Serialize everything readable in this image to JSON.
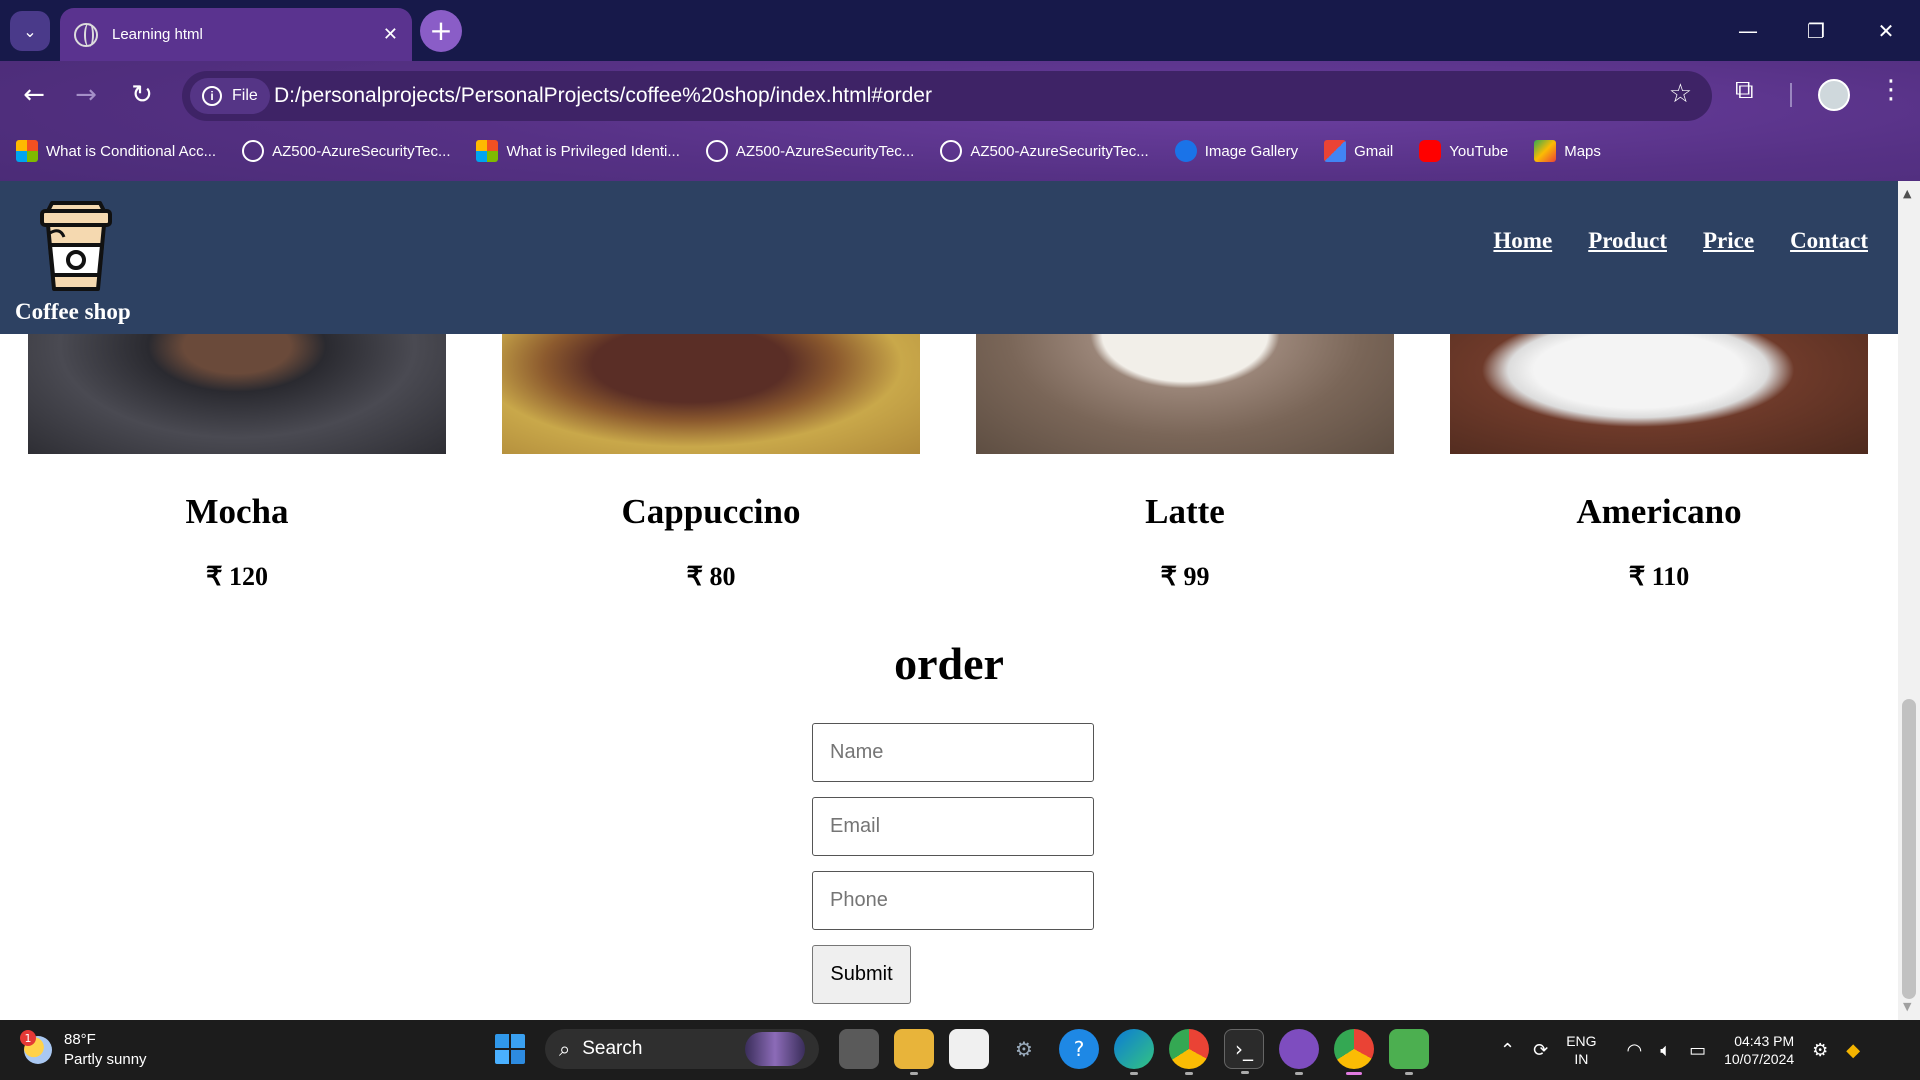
{
  "browser": {
    "tab_title": "Learning html",
    "file_chip": "File",
    "url": "D:/personalprojects/PersonalProjects/coffee%20shop/index.html#order",
    "bookmarks": [
      {
        "label": "What is Conditional Acc...",
        "icon": "microsoft-icon"
      },
      {
        "label": "AZ500-AzureSecurityTec...",
        "icon": "globe-icon"
      },
      {
        "label": "What is Privileged Identi...",
        "icon": "microsoft-icon"
      },
      {
        "label": "AZ500-AzureSecurityTec...",
        "icon": "globe-icon"
      },
      {
        "label": "AZ500-AzureSecurityTec...",
        "icon": "globe-icon"
      },
      {
        "label": "Image Gallery",
        "icon": "drop-icon"
      },
      {
        "label": "Gmail",
        "icon": "gmail-icon"
      },
      {
        "label": "YouTube",
        "icon": "youtube-icon"
      },
      {
        "label": "Maps",
        "icon": "maps-icon"
      }
    ]
  },
  "site": {
    "brand": "Coffee shop",
    "nav": [
      "Home",
      "Product",
      "Price",
      "Contact"
    ],
    "products": [
      {
        "name": "Mocha",
        "price": "₹ 120"
      },
      {
        "name": "Cappuccino",
        "price": "₹ 80"
      },
      {
        "name": "Latte",
        "price": "₹ 99"
      },
      {
        "name": "Americano",
        "price": "₹ 110"
      }
    ],
    "order": {
      "title": "order",
      "name_placeholder": "Name",
      "email_placeholder": "Email",
      "phone_placeholder": "Phone",
      "submit_label": "Submit"
    }
  },
  "taskbar": {
    "weather_badge": "1",
    "temperature": "88°F",
    "condition": "Partly sunny",
    "search_label": "Search",
    "lang_line1": "ENG",
    "lang_line2": "IN",
    "time": "04:43 PM",
    "date": "10/07/2024"
  },
  "colors": {
    "header_bg": "#2d4162",
    "chrome_purple": "#563185",
    "tabstrip": "#17194a",
    "taskbar": "#1c1c1c"
  }
}
